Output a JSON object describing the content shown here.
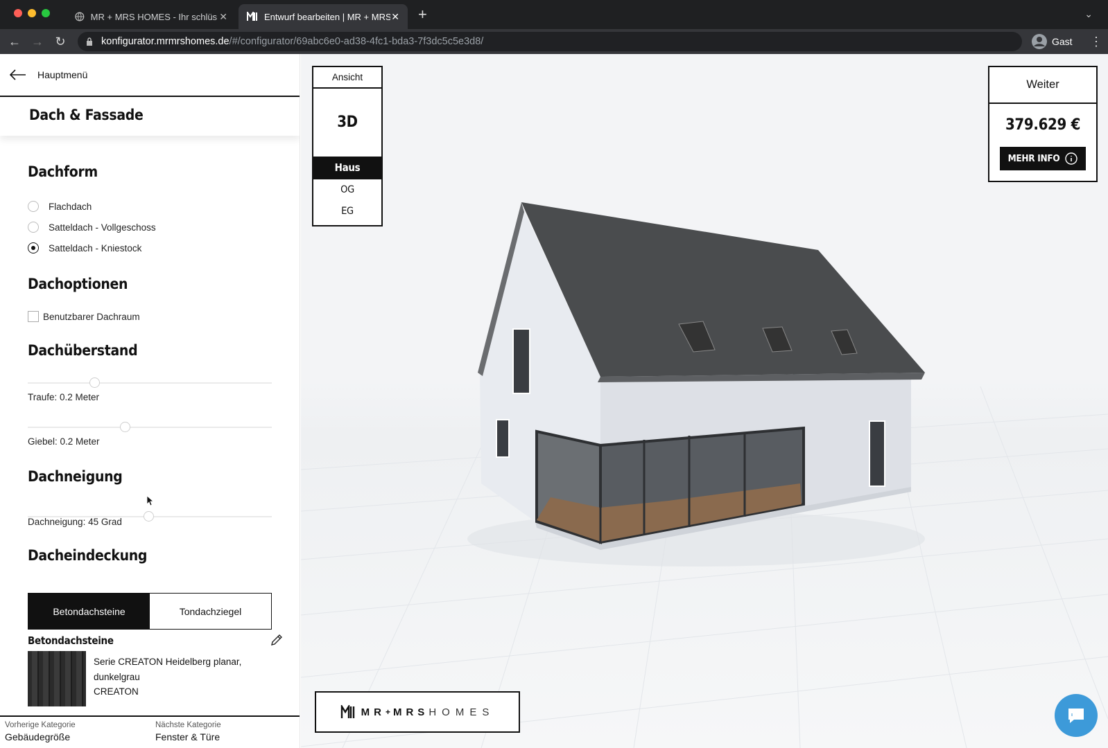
{
  "browser": {
    "tabs": [
      {
        "title": "MR + MRS HOMES - Ihr schlüs",
        "active": false
      },
      {
        "title": "Entwurf bearbeiten | MR + MRS",
        "active": true
      }
    ],
    "url_host": "konfigurator.mrmrshomes.de",
    "url_path": "/#/configurator/69abc6e0-ad38-4fc1-bda3-7f3dc5c5e3d8/",
    "profile": "Gast"
  },
  "sidebar": {
    "back_label": "Hauptmenü",
    "section_title": "Dach & Fassade",
    "dachform": {
      "title": "Dachform",
      "options": [
        {
          "label": "Flachdach",
          "selected": false
        },
        {
          "label": "Satteldach - Vollgeschoss",
          "selected": false
        },
        {
          "label": "Satteldach - Kniestock",
          "selected": true
        }
      ]
    },
    "dachoptionen": {
      "title": "Dachoptionen",
      "checkbox_label": "Benutzbarer Dachraum",
      "checked": false
    },
    "dachueberstand": {
      "title": "Dachüberstand",
      "traufe_label": "Traufe: 0.2 Meter",
      "giebel_label": "Giebel: 0.2 Meter"
    },
    "dachneigung": {
      "title": "Dachneigung",
      "label": "Dachneigung: 45 Grad"
    },
    "dacheindeckung": {
      "title": "Dacheindeckung",
      "tabs": [
        "Betondachsteine",
        "Tondachziegel"
      ],
      "active_tab": "Betondachsteine",
      "selection_title": "Betondachsteine",
      "product_line1": "Serie CREATON Heidelberg planar,",
      "product_line2": "dunkelgrau",
      "brand": "CREATON"
    },
    "footer": {
      "prev_key": "Vorherige Kategorie",
      "prev_value": "Gebäudegröße",
      "next_key": "Nächste Kategorie",
      "next_value": "Fenster & Türe"
    }
  },
  "viewport": {
    "ansicht_label": "Ansicht",
    "mode_label": "3D",
    "levels": [
      "Haus",
      "OG",
      "EG"
    ],
    "active_level": "Haus",
    "weiter_label": "Weiter",
    "price": "379.629 €",
    "mehr_info_label": "MEHR INFO",
    "logo_left": "MR",
    "logo_plus": "+",
    "logo_mid": "MRS",
    "logo_right": "HOMES"
  },
  "colors": {
    "accent": "#111111",
    "chat": "#3d9ad9",
    "roof": "#4a4c4e",
    "wall": "#e9ebef"
  }
}
